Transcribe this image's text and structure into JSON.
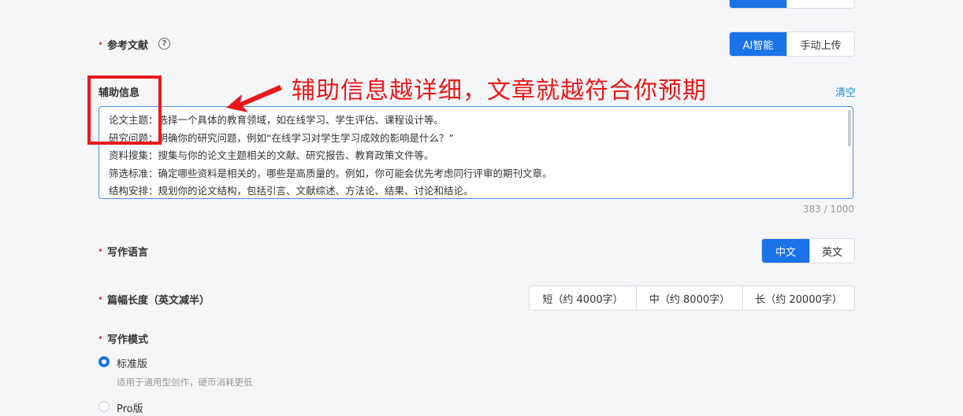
{
  "top_cutoff": {
    "label": ""
  },
  "reference": {
    "label": "参考文献",
    "options": [
      "AI智能",
      "手动上传"
    ],
    "selected": "AI智能"
  },
  "aux_info": {
    "label": "辅助信息",
    "clear_label": "清空",
    "lines": [
      "论文主题：选择一个具体的教育领域，如在线学习、学生评估、课程设计等。",
      "研究问题：明确你的研究问题，例如“在线学习对学生学习成效的影响是什么？”",
      "资料搜集：搜集与你的论文主题相关的文献、研究报告、教育政策文件等。",
      "筛选标准：确定哪些资料是相关的，哪些是高质量的。例如，你可能会优先考虑同行评审的期刊文章。",
      "结构安排：规划你的论文结构，包括引言、文献综述、方法论、结果、讨论和结论。"
    ],
    "counter": "383 / 1000"
  },
  "annotation": {
    "text": "辅助信息越详细，文章就越符合你预期",
    "color": "#e8191a"
  },
  "language": {
    "label": "写作语言",
    "options": [
      "中文",
      "英文"
    ],
    "selected": "中文"
  },
  "length": {
    "label": "篇幅长度（英文减半）",
    "options": [
      "短（约 4000字）",
      "中（约 8000字）",
      "长（约 20000字）"
    ]
  },
  "mode": {
    "label": "写作模式",
    "standard_label": "标准版",
    "standard_desc": "适用于通用型创作，硬币消耗更低",
    "pro_label": "Pro版",
    "selected": "标准版"
  },
  "colors": {
    "accent": "#1a73e8",
    "required": "#e0463b",
    "annotation": "#e8191a"
  }
}
